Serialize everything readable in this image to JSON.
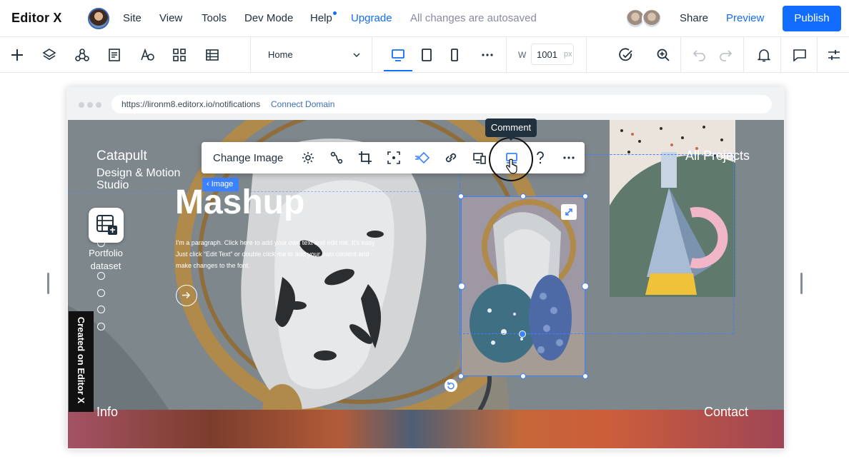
{
  "app": {
    "logo": "Editor X",
    "menu": [
      "Site",
      "View",
      "Tools",
      "Dev Mode",
      "Help",
      "Upgrade"
    ],
    "autosave_status": "All changes are autosaved",
    "share_label": "Share",
    "preview_label": "Preview",
    "publish_label": "Publish"
  },
  "toolbar": {
    "page_select": "Home",
    "width_label": "W",
    "width_value": "1001",
    "width_unit": "px",
    "active_device": "desktop"
  },
  "browser": {
    "url": "https://lironm8.editorx.io/notifications",
    "connect_domain": "Connect Domain"
  },
  "site": {
    "brand_line1": "Catapult",
    "brand_line2": "Design & Motion",
    "brand_line3": "Studio",
    "heading": "Mashup",
    "paragraph": "I'm a paragraph. Click here to add your own text and edit me. It's easy. Just click “Edit Text” or double click me to add your own content and make changes to the font.",
    "all_projects": "All Projects",
    "info": "Info",
    "contact": "Contact",
    "created_badge": "Created on Editor X"
  },
  "dataset": {
    "label": "Portfolio dataset"
  },
  "element_toolbar": {
    "change_image": "Change Image",
    "tooltip": "Comment",
    "selected_tag": "‹ Image"
  },
  "colors": {
    "accent": "#116dff",
    "selection": "#3c82ff"
  }
}
